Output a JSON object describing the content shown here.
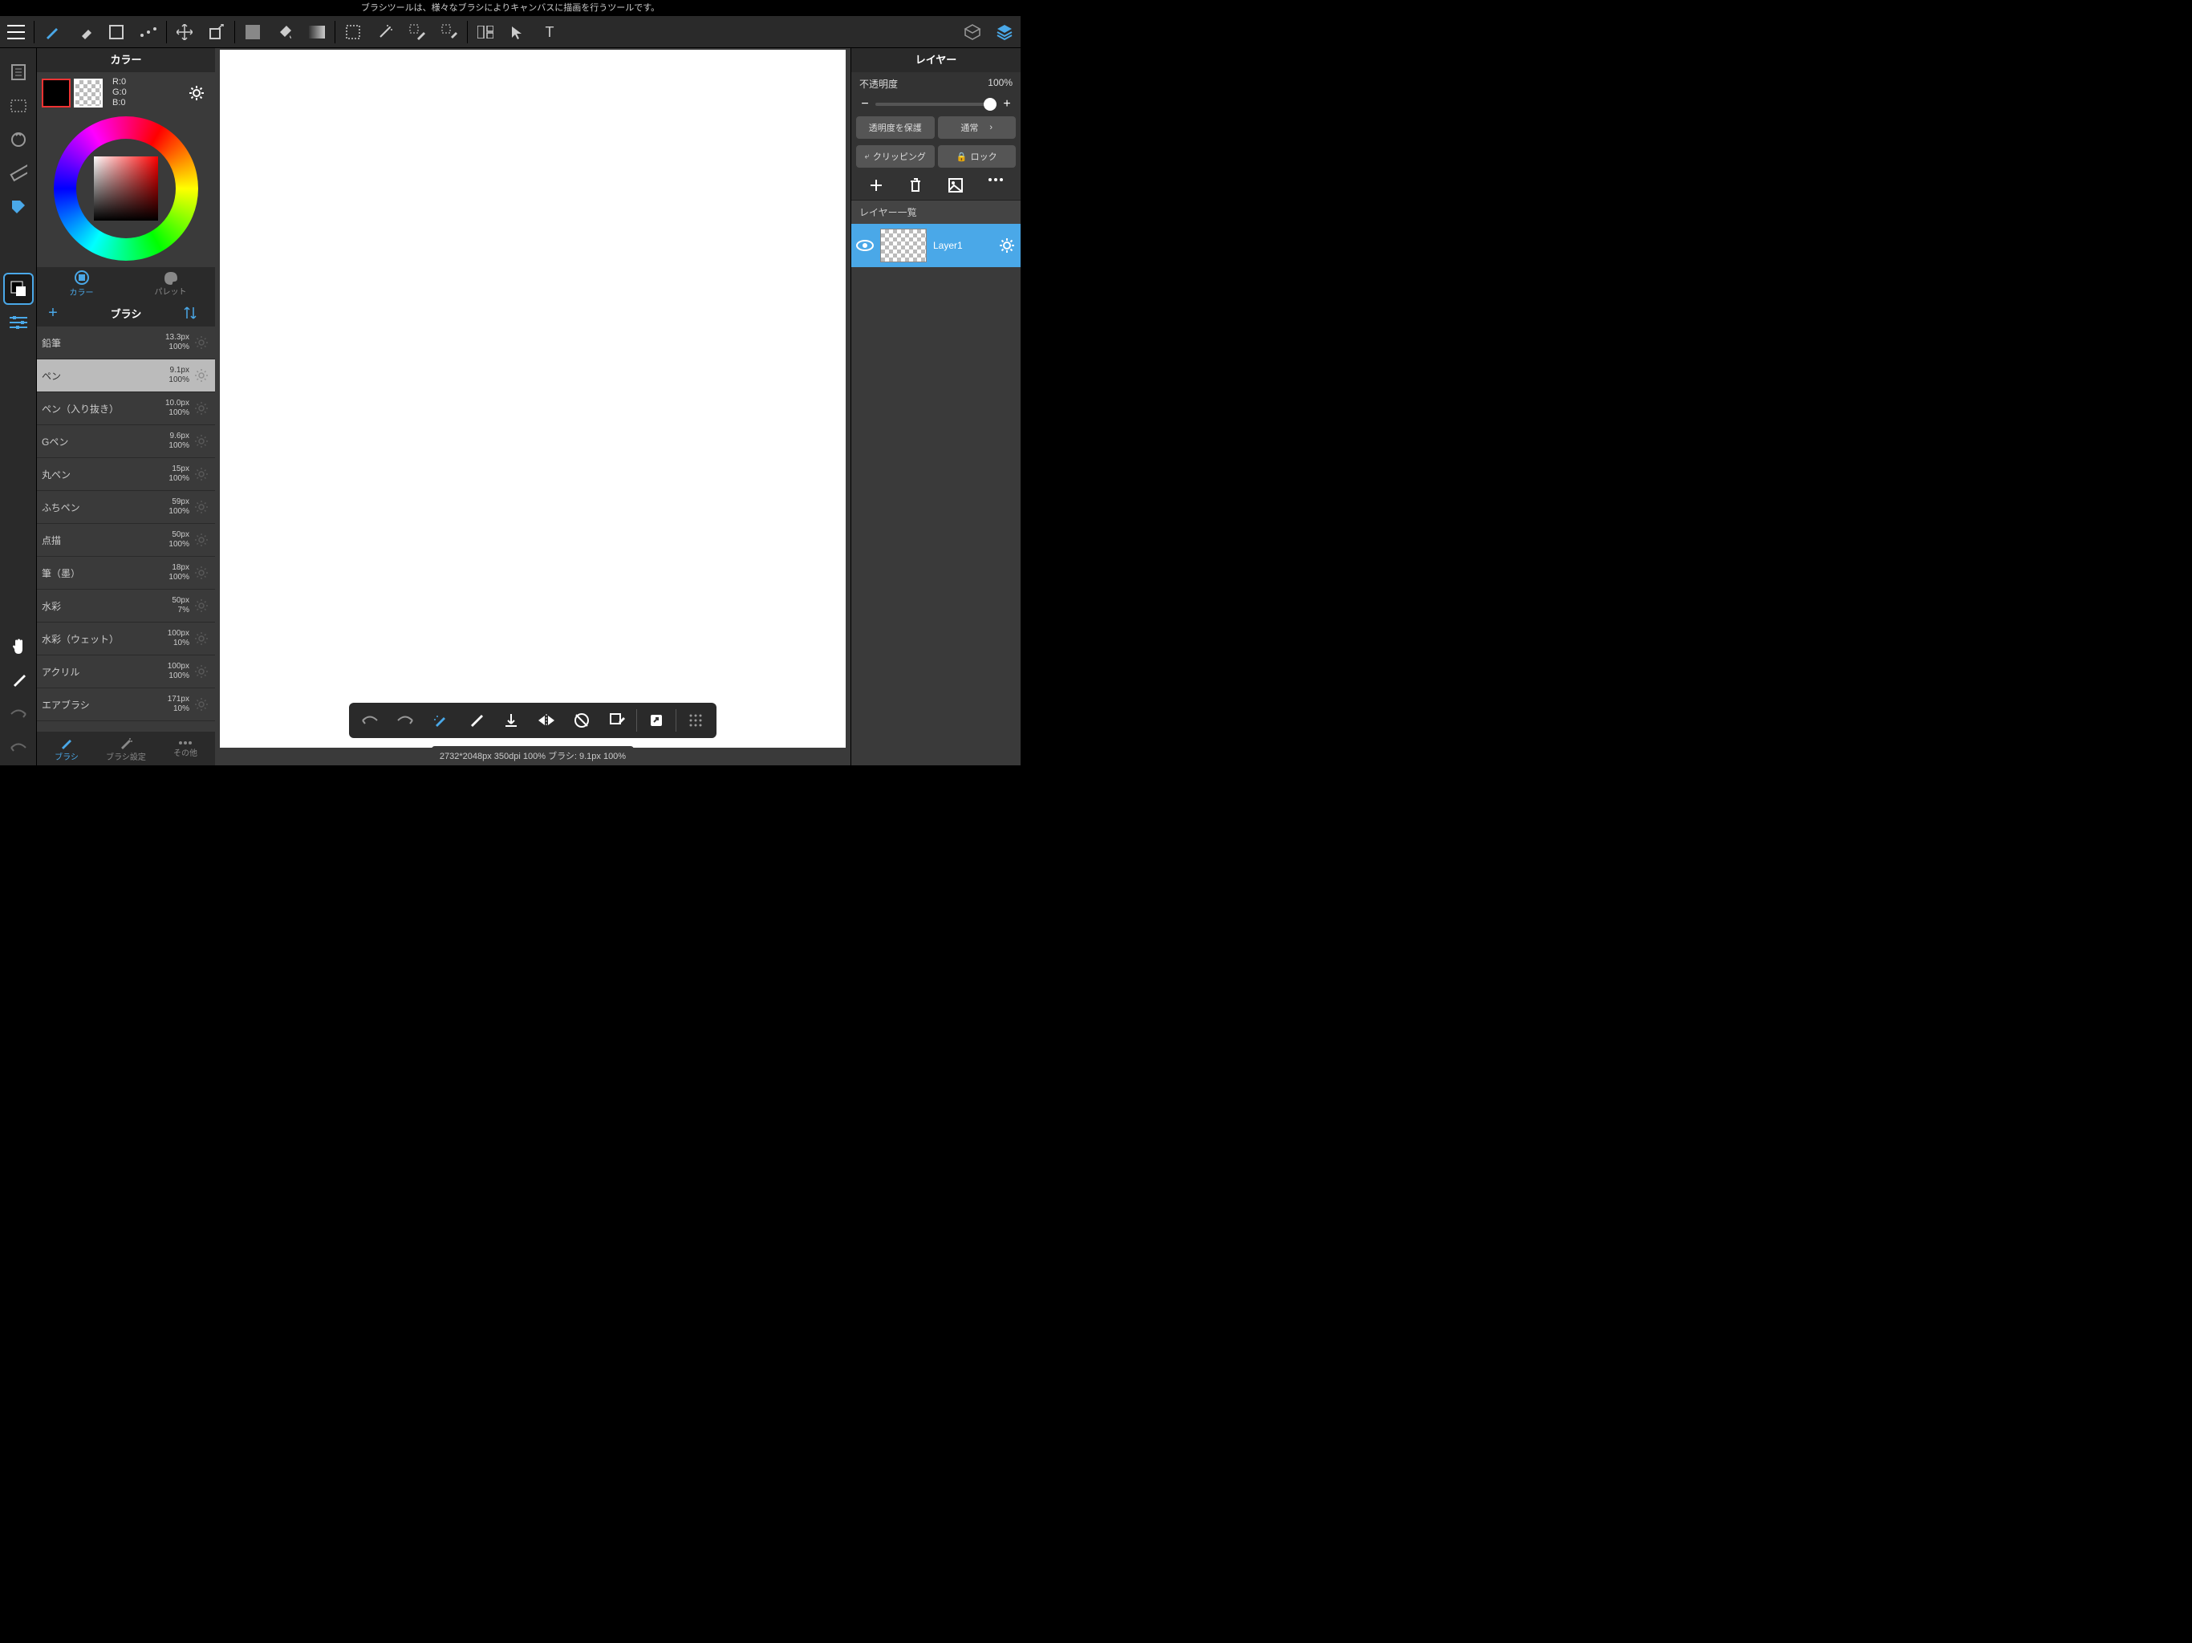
{
  "top_message": "ブラシツールは、様々なブラシによりキャンバスに描画を行うツールです。",
  "color_panel": {
    "title": "カラー",
    "rgb": {
      "r": "R:0",
      "g": "G:0",
      "b": "B:0"
    },
    "tabs": {
      "color": "カラー",
      "palette": "パレット"
    }
  },
  "brush_panel": {
    "title": "ブラシ",
    "tabs": {
      "brush": "ブラシ",
      "settings": "ブラシ設定",
      "other": "その他"
    },
    "items": [
      {
        "name": "鉛筆",
        "size": "13.3px",
        "opacity": "100%",
        "selected": false
      },
      {
        "name": "ペン",
        "size": "9.1px",
        "opacity": "100%",
        "selected": true
      },
      {
        "name": "ペン（入り抜き）",
        "size": "10.0px",
        "opacity": "100%",
        "selected": false
      },
      {
        "name": "Gペン",
        "size": "9.6px",
        "opacity": "100%",
        "selected": false
      },
      {
        "name": "丸ペン",
        "size": "15px",
        "opacity": "100%",
        "selected": false
      },
      {
        "name": "ふちペン",
        "size": "59px",
        "opacity": "100%",
        "selected": false
      },
      {
        "name": "点描",
        "size": "50px",
        "opacity": "100%",
        "selected": false
      },
      {
        "name": "筆（墨）",
        "size": "18px",
        "opacity": "100%",
        "selected": false
      },
      {
        "name": "水彩",
        "size": "50px",
        "opacity": "7%",
        "selected": false
      },
      {
        "name": "水彩（ウェット）",
        "size": "100px",
        "opacity": "10%",
        "selected": false
      },
      {
        "name": "アクリル",
        "size": "100px",
        "opacity": "100%",
        "selected": false
      },
      {
        "name": "エアブラシ",
        "size": "171px",
        "opacity": "10%",
        "selected": false
      }
    ]
  },
  "layer_panel": {
    "title": "レイヤー",
    "opacity_label": "不透明度",
    "opacity_value": "100%",
    "protect_alpha": "透明度を保護",
    "blend_mode": "通常",
    "clipping": "クリッピング",
    "lock": "ロック",
    "list_header": "レイヤー一覧",
    "layers": [
      {
        "name": "Layer1"
      }
    ]
  },
  "status_bar": "2732*2048px 350dpi 100% ブラシ:  9.1px 100%"
}
